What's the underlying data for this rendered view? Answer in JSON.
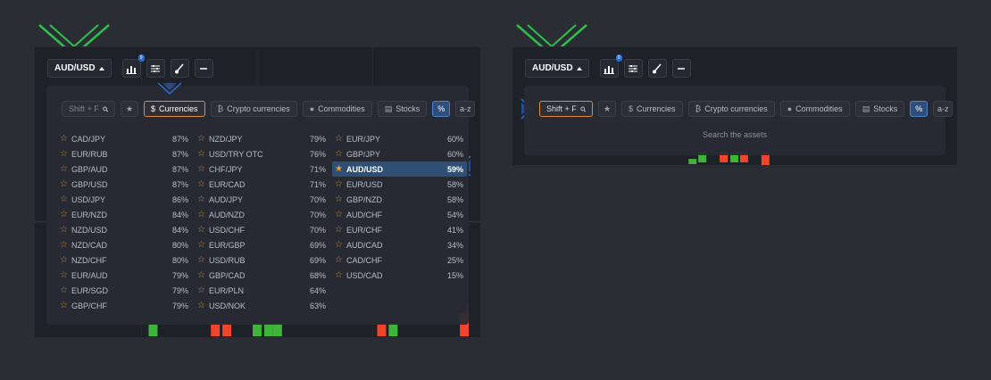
{
  "left_panel": {
    "pair_label": "AUD/USD",
    "indicator_badge": "9",
    "search": {
      "placeholder": "Shift + F"
    },
    "tabs": [
      {
        "label": "Currencies",
        "icon": "dollar-icon"
      },
      {
        "label": "Crypto currencies",
        "icon": "bitcoin-icon"
      },
      {
        "label": "Commodities",
        "icon": "drop-icon"
      },
      {
        "label": "Stocks",
        "icon": "document-icon"
      }
    ],
    "sort_percent_label": "%",
    "sort_az_label": "a-z",
    "columns": [
      [
        {
          "name": "CAD/JPY",
          "value": "87%"
        },
        {
          "name": "EUR/RUB",
          "value": "87%"
        },
        {
          "name": "GBP/AUD",
          "value": "87%"
        },
        {
          "name": "GBP/USD",
          "value": "87%"
        },
        {
          "name": "USD/JPY",
          "value": "86%"
        },
        {
          "name": "EUR/NZD",
          "value": "84%"
        },
        {
          "name": "NZD/USD",
          "value": "84%"
        },
        {
          "name": "NZD/CAD",
          "value": "80%"
        },
        {
          "name": "NZD/CHF",
          "value": "80%"
        },
        {
          "name": "EUR/AUD",
          "value": "79%"
        },
        {
          "name": "EUR/SGD",
          "value": "79%"
        },
        {
          "name": "GBP/CHF",
          "value": "79%"
        }
      ],
      [
        {
          "name": "NZD/JPY",
          "value": "79%"
        },
        {
          "name": "USD/TRY OTC",
          "value": "76%"
        },
        {
          "name": "CHF/JPY",
          "value": "71%"
        },
        {
          "name": "EUR/CAD",
          "value": "71%"
        },
        {
          "name": "AUD/JPY",
          "value": "70%"
        },
        {
          "name": "AUD/NZD",
          "value": "70%"
        },
        {
          "name": "USD/CHF",
          "value": "70%"
        },
        {
          "name": "EUR/GBP",
          "value": "69%"
        },
        {
          "name": "USD/RUB",
          "value": "69%"
        },
        {
          "name": "GBP/CAD",
          "value": "68%"
        },
        {
          "name": "EUR/PLN",
          "value": "64%"
        },
        {
          "name": "USD/NOK",
          "value": "63%"
        }
      ],
      [
        {
          "name": "EUR/JPY",
          "value": "60%"
        },
        {
          "name": "GBP/JPY",
          "value": "60%"
        },
        {
          "name": "AUD/USD",
          "value": "59%",
          "selected": true,
          "favorite": true
        },
        {
          "name": "EUR/USD",
          "value": "58%"
        },
        {
          "name": "GBP/NZD",
          "value": "58%"
        },
        {
          "name": "AUD/CHF",
          "value": "54%"
        },
        {
          "name": "EUR/CHF",
          "value": "41%"
        },
        {
          "name": "AUD/CAD",
          "value": "34%"
        },
        {
          "name": "CAD/CHF",
          "value": "25%"
        },
        {
          "name": "USD/CAD",
          "value": "15%"
        }
      ]
    ]
  },
  "right_panel": {
    "pair_label": "AUD/USD",
    "indicator_badge": "9",
    "search": {
      "placeholder": "Shift + F"
    },
    "tabs": [
      {
        "label": "Currencies",
        "icon": "dollar-icon"
      },
      {
        "label": "Crypto currencies",
        "icon": "bitcoin-icon"
      },
      {
        "label": "Commodities",
        "icon": "drop-icon"
      },
      {
        "label": "Stocks",
        "icon": "document-icon"
      }
    ],
    "sort_percent_label": "%",
    "sort_az_label": "a-z",
    "hint": "Search the assets"
  },
  "colors": {
    "background": "#2b2d35",
    "panel": "#1f2129",
    "accent_orange": "#e28a3a",
    "accent_blue": "#2b6fd6",
    "candle_green": "#3fb33a",
    "candle_red": "#f0452a",
    "highlight_green": "#2fbf4a"
  }
}
